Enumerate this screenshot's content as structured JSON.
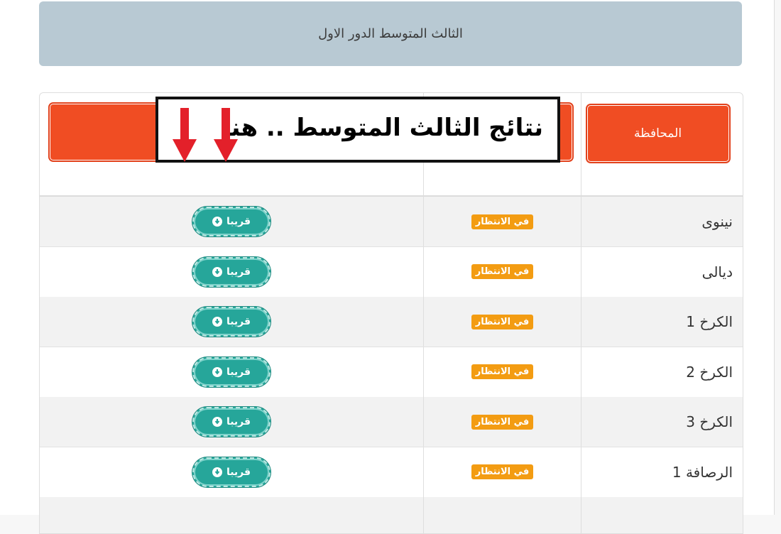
{
  "page": {
    "title": "الثالث المتوسط الدور الاول"
  },
  "table": {
    "header": {
      "governorate_label": "المحافظة"
    },
    "rows": [
      {
        "governorate": "نينوى",
        "status": "في الانتظار",
        "action": "قريبا"
      },
      {
        "governorate": "ديالى",
        "status": "في الانتظار",
        "action": "قريبا"
      },
      {
        "governorate": "الكرخ 1",
        "status": "في الانتظار",
        "action": "قريبا"
      },
      {
        "governorate": "الكرخ 2",
        "status": "في الانتظار",
        "action": "قريبا"
      },
      {
        "governorate": "الكرخ 3",
        "status": "في الانتظار",
        "action": "قريبا"
      },
      {
        "governorate": "الرصافة 1",
        "status": "في الانتظار",
        "action": "قريبا"
      },
      {
        "governorate": "",
        "status": "",
        "action": ""
      }
    ]
  },
  "overlay": {
    "text": "نتائج الثالث المتوسط .. هنا",
    "arrow_color": "#e3202a"
  },
  "colors": {
    "header_button": "#f04d23",
    "status_badge": "#f39c12",
    "soon_button": "#26a69a",
    "title_bar": "#b8c9d3"
  },
  "icons": {
    "soon_button_icon": "download-circle-icon",
    "overlay_arrows": "arrow-down-icon"
  }
}
